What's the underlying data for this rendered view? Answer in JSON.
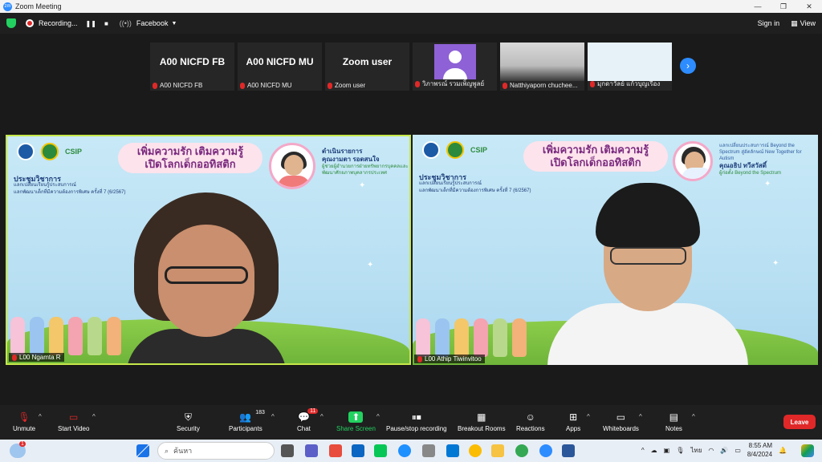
{
  "window": {
    "app_icon": "zm",
    "title": "Zoom Meeting",
    "controls": [
      "—",
      "❐",
      "✕"
    ]
  },
  "topbar": {
    "recording_label": "Recording...",
    "pause_glyph": "❚❚",
    "stop_glyph": "■",
    "facebook_label": "Facebook",
    "signin_label": "Sign in",
    "view_label": "View"
  },
  "strip": [
    {
      "big": "A00 NICFD FB",
      "caption": "A00 NICFD FB"
    },
    {
      "big": "A00 NICFD MU",
      "caption": "A00 NICFD MU"
    },
    {
      "big": "Zoom user",
      "caption": "Zoom user"
    },
    {
      "big": "",
      "caption": "วิภาพรณ์ รวมเพ็ญพูลย์"
    },
    {
      "big": "",
      "caption": "Natthiyaporn chuchee..."
    },
    {
      "big": "",
      "caption": "มุกดาวัลย์ แก้วบุญเรือง"
    }
  ],
  "slide": {
    "banner_line1": "เพิ่มความรัก เติมความรู้",
    "banner_line2": "เปิดโลกเด็กออทิสติก",
    "meeting_title": "ประชุมวิชาการ",
    "meeting_sub1": "แลกเปลี่ยนเรียนรู้ประสบการณ์",
    "meeting_sub2": "แลกพัฒนาเด็กที่มีความต้องการพิเศษ ครั้งที่ 7 (6/2567)",
    "csip": "CSIP"
  },
  "tiles": [
    {
      "name": "L00 Ngamta R",
      "speaker_role": "ดำเนินรายการ",
      "speaker_name": "คุณงามตา รอดสนใจ",
      "speaker_desc": "ผู้ช่วยผู้อำนวยการฝ่ายทรัพยากรบุคคลและพัฒนาศักยภาพบุคลากรประเทศ"
    },
    {
      "name": "L00 Athip Tiwinvitoo",
      "speaker_role": "แลกเปลี่ยนประสบการณ์ Beyond the Spectrum สู่อัตลักษณ์ New Together for Autism",
      "speaker_name": "คุณอธิป ทวีสวัสดิ์",
      "speaker_desc": "ผู้ก่อตั้ง Beyond the Spectrum"
    }
  ],
  "bottombar": {
    "unmute": "Unmute",
    "start_video": "Start Video",
    "security": "Security",
    "participants": "Participants",
    "participants_count": "183",
    "chat": "Chat",
    "chat_badge": "11",
    "share_screen": "Share Screen",
    "pause_recording": "Pause/stop recording",
    "breakout_rooms": "Breakout Rooms",
    "reactions": "Reactions",
    "apps": "Apps",
    "whiteboards": "Whiteboards",
    "notes": "Notes",
    "leave": "Leave"
  },
  "taskbar": {
    "search_placeholder": "ค้นหา",
    "lang": "ไทย",
    "time": "8:55 AM",
    "date": "8/4/2024",
    "weather_badge": "1"
  },
  "colors": {
    "accent": "#2d8cff",
    "active_speaker_border": "#c6e84a",
    "leave": "#e02828",
    "share": "#23d160"
  }
}
